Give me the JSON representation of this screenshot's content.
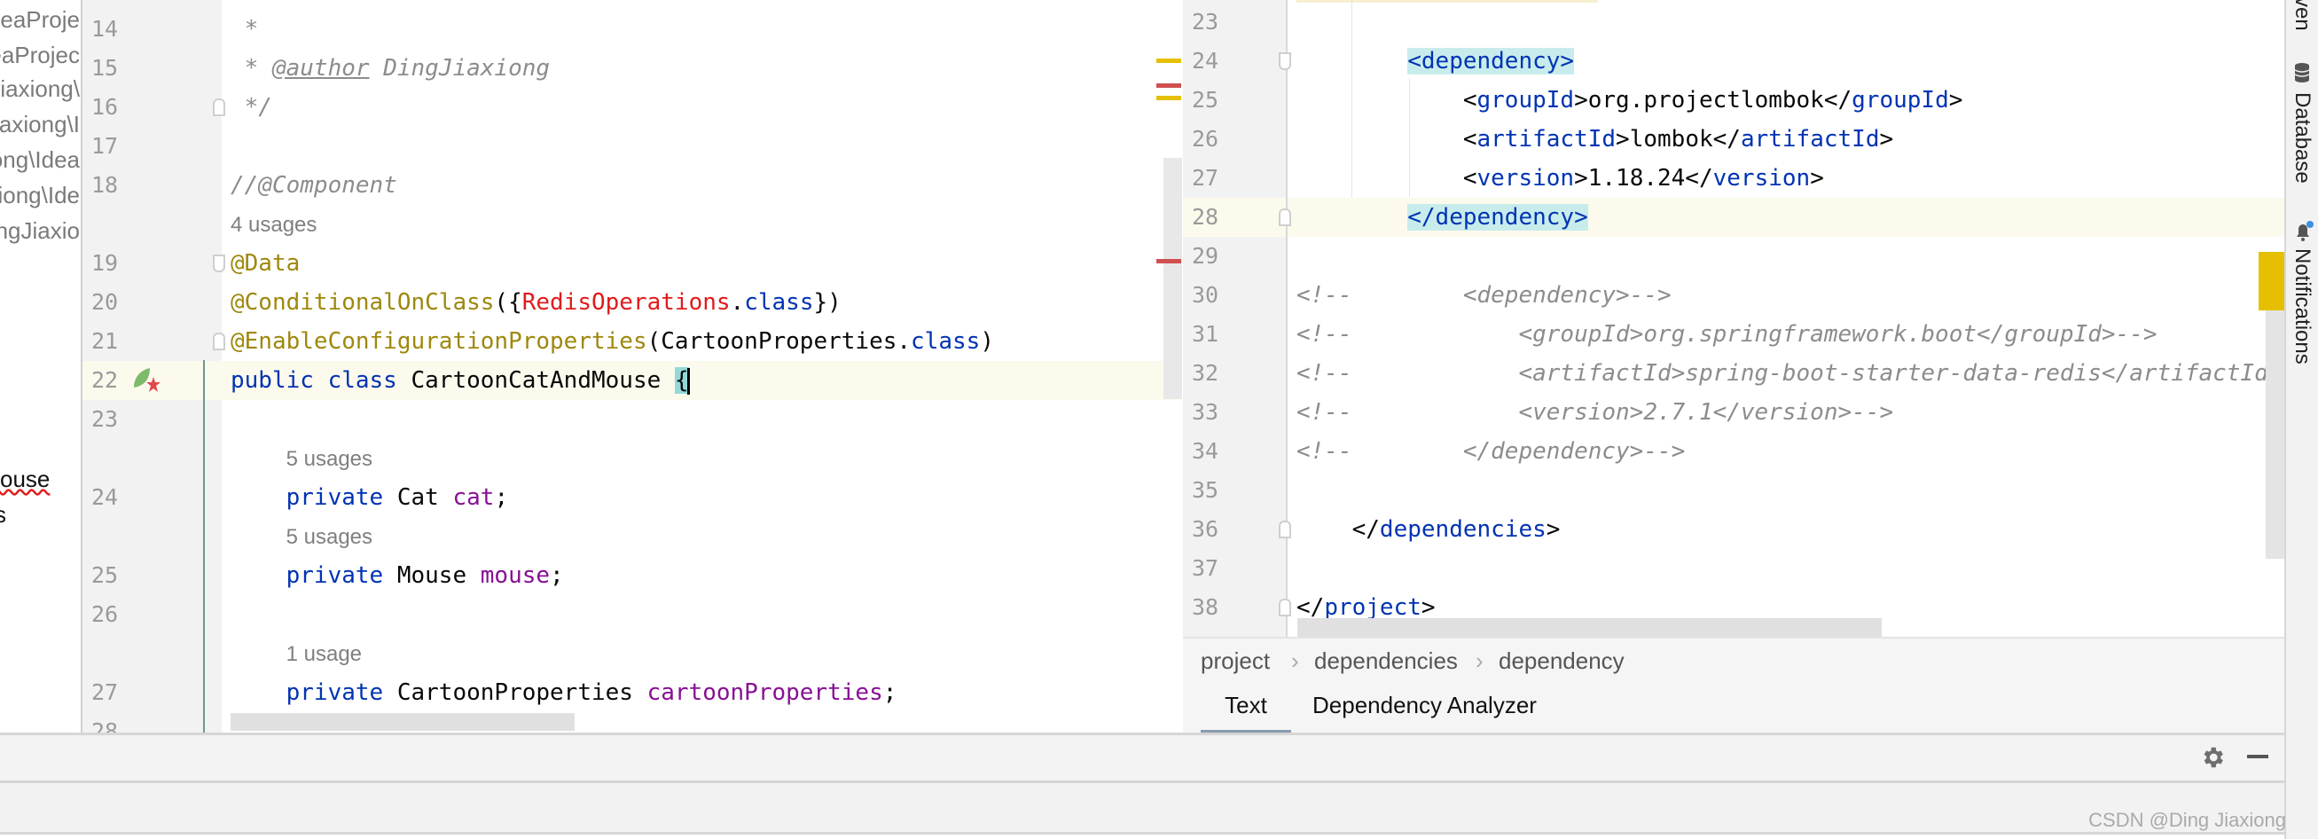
{
  "project_tree": {
    "items": [
      "ideaProje",
      "eaProjec",
      "Jiaxiong\\",
      "iaxiong\\I",
      "ong\\Idea",
      "iong\\Ide",
      "ngJiaxio"
    ],
    "lower_items": [
      "ouse",
      "s"
    ]
  },
  "left_editor": {
    "rows": [
      {
        "kind": "code",
        "num": "14",
        "tokens": [
          {
            "t": " *",
            "c": "doc"
          }
        ]
      },
      {
        "kind": "code",
        "num": "15",
        "tokens": [
          {
            "t": " * ",
            "c": "doc"
          },
          {
            "t": "@author",
            "c": "doctag"
          },
          {
            "t": " DingJiaxiong",
            "c": "doc"
          }
        ]
      },
      {
        "kind": "code",
        "num": "16",
        "fold": "end",
        "tokens": [
          {
            "t": " */",
            "c": "doc"
          }
        ]
      },
      {
        "kind": "code",
        "num": "17",
        "tokens": []
      },
      {
        "kind": "code",
        "num": "18",
        "tokens": [
          {
            "t": "//@Component",
            "c": "cmt"
          }
        ]
      },
      {
        "kind": "hint",
        "text": "4 usages"
      },
      {
        "kind": "code",
        "num": "19",
        "fold": "start",
        "tokens": [
          {
            "t": "@Data",
            "c": "ann"
          }
        ]
      },
      {
        "kind": "code",
        "num": "20",
        "tokens": [
          {
            "t": "@ConditionalOnClass",
            "c": "ann"
          },
          {
            "t": "({",
            "c": ""
          },
          {
            "t": "RedisOperations",
            "c": "err"
          },
          {
            "t": ".",
            "c": ""
          },
          {
            "t": "class",
            "c": "kw"
          },
          {
            "t": "})",
            "c": ""
          }
        ]
      },
      {
        "kind": "code",
        "num": "21",
        "fold": "end",
        "tokens": [
          {
            "t": "@EnableConfigurationProperties",
            "c": "ann"
          },
          {
            "t": "(CartoonProperties.",
            "c": ""
          },
          {
            "t": "class",
            "c": "kw"
          },
          {
            "t": ")",
            "c": ""
          }
        ]
      },
      {
        "kind": "code",
        "num": "22",
        "current": true,
        "gutter_icons": [
          "spring-bean-icon"
        ],
        "tokens": [
          {
            "t": "public class",
            "c": "kw"
          },
          {
            "t": " CartoonCatAndMouse ",
            "c": ""
          },
          {
            "t": "{",
            "c": "brace-hl"
          },
          {
            "t": "",
            "c": "caret"
          }
        ]
      },
      {
        "kind": "code",
        "num": "23",
        "tokens": []
      },
      {
        "kind": "hint",
        "indent": "    ",
        "text": "5 usages"
      },
      {
        "kind": "code",
        "num": "24",
        "tokens": [
          {
            "t": "    private",
            "c": "kw"
          },
          {
            "t": " Cat ",
            "c": ""
          },
          {
            "t": "cat",
            "c": "fld"
          },
          {
            "t": ";",
            "c": ""
          }
        ]
      },
      {
        "kind": "hint",
        "indent": "    ",
        "text": "5 usages"
      },
      {
        "kind": "code",
        "num": "25",
        "tokens": [
          {
            "t": "    private",
            "c": "kw"
          },
          {
            "t": " Mouse ",
            "c": ""
          },
          {
            "t": "mouse",
            "c": "fld"
          },
          {
            "t": ";",
            "c": ""
          }
        ]
      },
      {
        "kind": "code",
        "num": "26",
        "tokens": []
      },
      {
        "kind": "hint",
        "indent": "    ",
        "text": "1 usage"
      },
      {
        "kind": "code",
        "num": "27",
        "tokens": [
          {
            "t": "    private",
            "c": "kw"
          },
          {
            "t": " CartoonProperties ",
            "c": ""
          },
          {
            "t": "cartoonProperties",
            "c": "fld"
          },
          {
            "t": ";",
            "c": ""
          }
        ]
      },
      {
        "kind": "code",
        "num": "28",
        "tokens": []
      }
    ]
  },
  "right_editor": {
    "rows": [
      {
        "kind": "code",
        "num": "23",
        "tokens": []
      },
      {
        "kind": "code",
        "num": "24",
        "fold": "start",
        "tokens": [
          {
            "t": "        ",
            "c": ""
          },
          {
            "t": "<dependency>",
            "c": "tag tag-hl"
          }
        ]
      },
      {
        "kind": "code",
        "num": "25",
        "tokens": [
          {
            "t": "            <",
            "c": ""
          },
          {
            "t": "groupId",
            "c": "tag"
          },
          {
            "t": ">org.projectlombok</",
            "c": ""
          },
          {
            "t": "groupId",
            "c": "tag"
          },
          {
            "t": ">",
            "c": ""
          }
        ]
      },
      {
        "kind": "code",
        "num": "26",
        "tokens": [
          {
            "t": "            <",
            "c": ""
          },
          {
            "t": "artifactId",
            "c": "tag"
          },
          {
            "t": ">lombok</",
            "c": ""
          },
          {
            "t": "artifactId",
            "c": "tag"
          },
          {
            "t": ">",
            "c": ""
          }
        ]
      },
      {
        "kind": "code",
        "num": "27",
        "tokens": [
          {
            "t": "            <",
            "c": ""
          },
          {
            "t": "version",
            "c": "tag"
          },
          {
            "t": ">1.18.24</",
            "c": ""
          },
          {
            "t": "version",
            "c": "tag"
          },
          {
            "t": ">",
            "c": ""
          }
        ]
      },
      {
        "kind": "code",
        "num": "28",
        "fold": "end",
        "current": true,
        "tokens": [
          {
            "t": "        ",
            "c": ""
          },
          {
            "t": "</dependency>",
            "c": "tag tag-hl"
          }
        ]
      },
      {
        "kind": "code",
        "num": "29",
        "tokens": []
      },
      {
        "kind": "code",
        "num": "30",
        "tokens": [
          {
            "t": "<!--        <dependency>-->",
            "c": "cmt"
          }
        ]
      },
      {
        "kind": "code",
        "num": "31",
        "tokens": [
          {
            "t": "<!--            <groupId>org.springframework.boot</groupId>-->",
            "c": "cmt"
          }
        ]
      },
      {
        "kind": "code",
        "num": "32",
        "tokens": [
          {
            "t": "<!--            <artifactId>spring-boot-starter-data-redis</artifactId>-->",
            "c": "cmt"
          }
        ]
      },
      {
        "kind": "code",
        "num": "33",
        "tokens": [
          {
            "t": "<!--            <version>2.7.1</version>-->",
            "c": "cmt"
          }
        ]
      },
      {
        "kind": "code",
        "num": "34",
        "tokens": [
          {
            "t": "<!--        </dependency>-->",
            "c": "cmt"
          }
        ]
      },
      {
        "kind": "code",
        "num": "35",
        "tokens": []
      },
      {
        "kind": "code",
        "num": "36",
        "fold": "end",
        "tokens": [
          {
            "t": "    </",
            "c": ""
          },
          {
            "t": "dependencies",
            "c": "tag"
          },
          {
            "t": ">",
            "c": ""
          }
        ]
      },
      {
        "kind": "code",
        "num": "37",
        "tokens": []
      },
      {
        "kind": "code",
        "num": "38",
        "fold": "end",
        "tokens": [
          {
            "t": "</",
            "c": ""
          },
          {
            "t": "project",
            "c": "tag"
          },
          {
            "t": ">",
            "c": ""
          }
        ]
      }
    ],
    "breadcrumb": [
      "project",
      "dependencies",
      "dependency"
    ],
    "tabs": [
      {
        "label": "Text",
        "active": true
      },
      {
        "label": "Dependency Analyzer",
        "active": false
      }
    ]
  },
  "right_toolstrip": {
    "maven_label": "ven",
    "database_label": "Database",
    "notifications_label": "Notifications"
  },
  "bottom_panel": {
    "settings_icon": "gear-icon",
    "hide_icon": "minus-icon"
  },
  "watermark": "CSDN @Ding Jiaxiong",
  "colors": {
    "keyword": "#0033b3",
    "annotation": "#9e880d",
    "field": "#871094",
    "comment": "#8c8c8c",
    "error": "#e01b1b",
    "warning_marker": "#e6c000",
    "error_marker": "#d05050"
  }
}
